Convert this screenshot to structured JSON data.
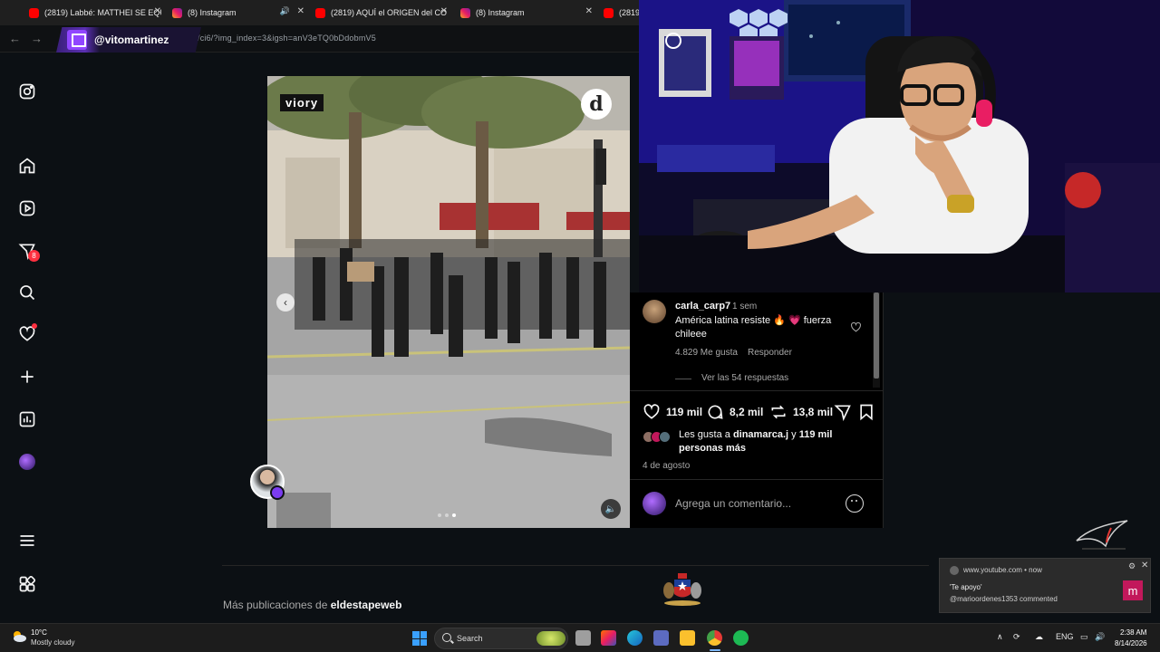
{
  "tabs": [
    {
      "label": "(2819) Labbé: MATTHEI SE EQU",
      "favicon": "youtube-icon",
      "close": "✕"
    },
    {
      "label": "(8) Instagram",
      "favicon": "instagram-icon",
      "close": "✕"
    },
    {
      "label": "(2819) AQUÍ el ORIGEN del CO",
      "favicon": "youtube-icon",
      "close": "✕"
    },
    {
      "label": "(8) Instagram",
      "favicon": "instagram-icon",
      "close": "✕"
    },
    {
      "label": "(2819",
      "favicon": "youtube-icon"
    }
  ],
  "address_bar": {
    "url": "/ci6/?img_index=3&igsh=anV3eTQ0bDdobmV5",
    "back": "←",
    "forward": "→"
  },
  "stream_overlay": {
    "channel": "@vitomartinez"
  },
  "sidebar": {
    "notification_count": "8",
    "items": [
      "instagram-logo-icon",
      "home-icon",
      "reels-icon",
      "messages-icon",
      "search-icon",
      "notifications-icon",
      "create-icon",
      "dashboard-icon",
      "profile-avatar",
      "more-menu-icon",
      "also-from-meta-icon"
    ]
  },
  "media": {
    "source_tag": "viory",
    "outlet_logo": "d",
    "prev": "‹",
    "mute": "🔈",
    "slide_index": 3,
    "slide_count": 3
  },
  "comment": {
    "username": "carla_carp7",
    "time": "1 sem",
    "text": "América latina resiste 🔥 💗 fuerza chileee",
    "likes": "4.829 Me gusta",
    "reply": "Responder",
    "view_replies": "Ver las 54 respuestas"
  },
  "actions": {
    "likes": "119 mil",
    "comments": "8,2 mil",
    "reposts": "13,8 mil"
  },
  "liked_by": {
    "prefix": "Les gusta a ",
    "user": "dinamarca.j",
    "middle": " y ",
    "others": "119 mil personas más"
  },
  "post_date": "4 de agosto",
  "compose": {
    "placeholder": "Agrega un comentario..."
  },
  "more_posts": {
    "prefix": "Más publicaciones de ",
    "account": "eldestapeweb"
  },
  "toast": {
    "site": "www.youtube.com  •  now",
    "title": "'Te apoyo'",
    "body": "@marioordenes1353 commented",
    "avatar_letter": "m"
  },
  "taskbar": {
    "weather_temp": "10°C",
    "weather_desc": "Mostly cloudy",
    "search_label": "Search",
    "language": "ENG",
    "time": "2:38 AM",
    "date": "8/14/2026"
  },
  "colors": {
    "instagram_bg": "#0c1014",
    "twitch_purple": "#9146ff",
    "notification_red": "#ff3040",
    "liked_heart": "#ff3040"
  }
}
